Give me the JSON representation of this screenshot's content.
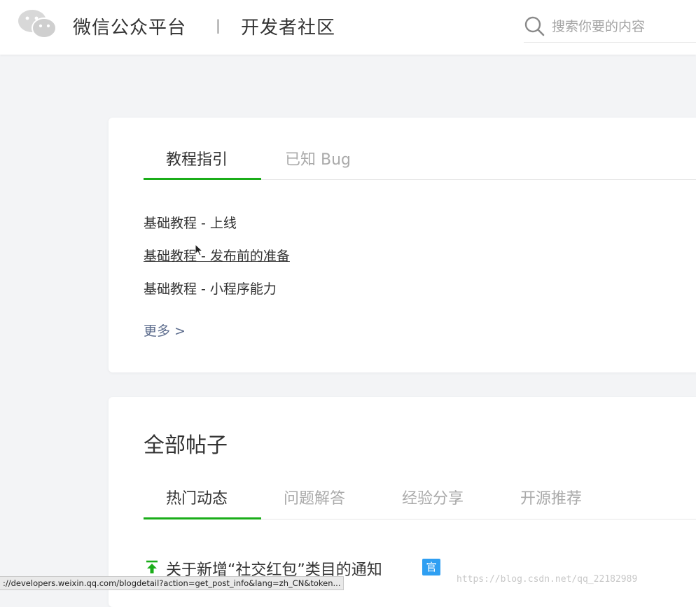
{
  "header": {
    "brand": "微信公众平台",
    "separator": "|",
    "section": "开发者社区",
    "logo_icon": "wechat-logo-icon",
    "search": {
      "icon": "search-icon",
      "placeholder": "搜索你要的内容"
    }
  },
  "tutorials": {
    "tabs": [
      {
        "label": "教程指引",
        "active": true
      },
      {
        "label": "已知 Bug",
        "active": false
      }
    ],
    "links": [
      {
        "label": "基础教程 - 上线"
      },
      {
        "label": "基础教程 - 发布前的准备"
      },
      {
        "label": "基础教程 - 小程序能力"
      }
    ],
    "more": "更多 >"
  },
  "posts": {
    "title": "全部帖子",
    "tabs": [
      {
        "label": "热门动态",
        "active": true
      },
      {
        "label": "问题解答",
        "active": false
      },
      {
        "label": "经验分享",
        "active": false
      },
      {
        "label": "开源推荐",
        "active": false
      }
    ],
    "items": [
      {
        "icon": "pin-top-icon",
        "title": "关于新增“社交红包”类目的通知",
        "badge": "官"
      }
    ]
  },
  "statusbar": {
    "url": "://developers.weixin.qq.com/blogdetail?action=get_post_info&lang=zh_CN&token..."
  },
  "watermark": "https://blog.csdn.net/qq_22182989",
  "colors": {
    "accent": "#1aad19",
    "badge": "#2f9ff2",
    "more_link": "#5b6b8c"
  }
}
